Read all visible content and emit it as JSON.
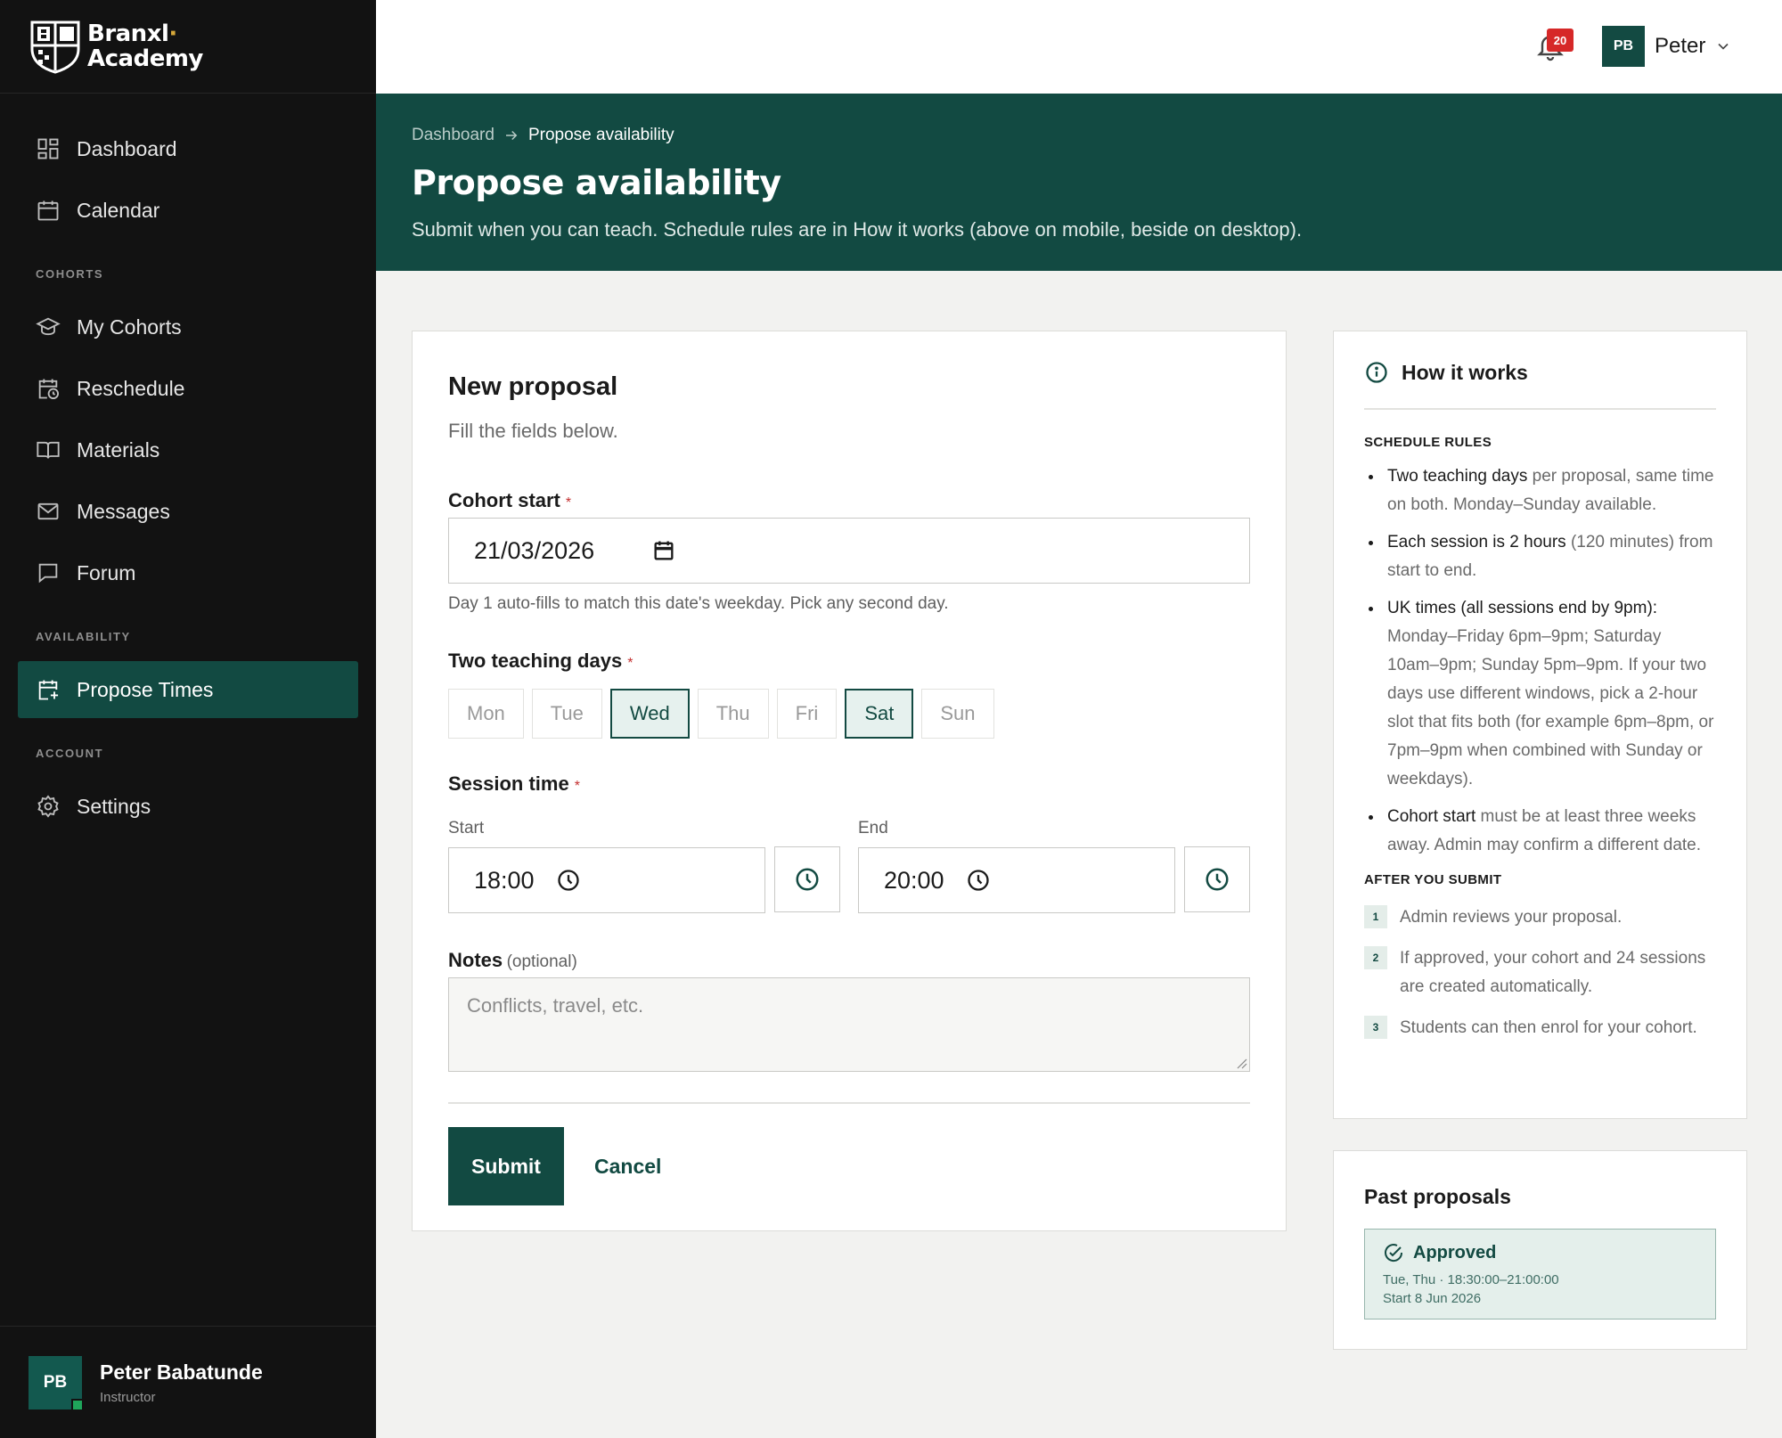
{
  "brand": {
    "line1": "Branxl",
    "line2": "Academy"
  },
  "sidebar": {
    "top_items": [
      {
        "label": "Dashboard",
        "icon": "dashboard-icon"
      },
      {
        "label": "Calendar",
        "icon": "calendar-icon"
      }
    ],
    "sections": [
      {
        "title": "COHORTS",
        "items": [
          {
            "label": "My Cohorts",
            "icon": "graduation-cap-icon"
          },
          {
            "label": "Reschedule",
            "icon": "calendar-clock-icon"
          },
          {
            "label": "Materials",
            "icon": "book-icon"
          },
          {
            "label": "Messages",
            "icon": "mail-icon"
          },
          {
            "label": "Forum",
            "icon": "chat-icon"
          }
        ]
      },
      {
        "title": "AVAILABILITY",
        "items": [
          {
            "label": "Propose Times",
            "icon": "calendar-plus-icon",
            "active": true
          }
        ]
      },
      {
        "title": "ACCOUNT",
        "items": [
          {
            "label": "Settings",
            "icon": "gear-icon"
          }
        ]
      }
    ],
    "profile": {
      "initials": "PB",
      "name": "Peter Babatunde",
      "role": "Instructor"
    }
  },
  "header": {
    "notification_count": "20",
    "user_initials": "PB",
    "user_name": "Peter"
  },
  "hero": {
    "breadcrumb_home": "Dashboard",
    "breadcrumb_current": "Propose availability",
    "title": "Propose availability",
    "subtitle": "Submit when you can teach. Schedule rules are in How it works (above on mobile, beside on desktop)."
  },
  "form": {
    "title": "New proposal",
    "subtitle": "Fill the fields below.",
    "cohort_start_label": "Cohort start",
    "cohort_start_value": "21/03/2026",
    "cohort_start_help": "Day 1 auto-fills to match this date's weekday. Pick any second day.",
    "teaching_days_label": "Two teaching days",
    "days": [
      {
        "label": "Mon",
        "selected": false
      },
      {
        "label": "Tue",
        "selected": false
      },
      {
        "label": "Wed",
        "selected": true
      },
      {
        "label": "Thu",
        "selected": false
      },
      {
        "label": "Fri",
        "selected": false
      },
      {
        "label": "Sat",
        "selected": true
      },
      {
        "label": "Sun",
        "selected": false
      }
    ],
    "session_time_label": "Session time",
    "start_label": "Start",
    "start_value": "18:00",
    "end_label": "End",
    "end_value": "20:00",
    "notes_label": "Notes",
    "notes_optional": "(optional)",
    "notes_placeholder": "Conflicts, travel, etc.",
    "submit_label": "Submit",
    "cancel_label": "Cancel"
  },
  "how": {
    "title": "How it works",
    "rules_title": "SCHEDULE RULES",
    "rules": [
      {
        "strong": "Two teaching days",
        "rest": " per proposal, same time on both. Monday–Sunday available."
      },
      {
        "strong": "Each session is 2 hours",
        "rest": " (120 minutes) from start to end."
      },
      {
        "strong": "UK times (all sessions end by 9pm):",
        "rest": " Monday–Friday 6pm–9pm; Saturday 10am–9pm; Sunday 5pm–9pm. If your two days use different windows, pick a 2-hour slot that fits both (for example 6pm–8pm, or 7pm–9pm when combined with Sunday or weekdays)."
      },
      {
        "strong": "Cohort start",
        "rest": " must be at least three weeks away. Admin may confirm a different date."
      }
    ],
    "after_title": "AFTER YOU SUBMIT",
    "steps": [
      {
        "num": "1",
        "text": "Admin reviews your proposal."
      },
      {
        "num": "2",
        "text": "If approved, your cohort and 24 sessions are created automatically."
      },
      {
        "num": "3",
        "text": "Students can then enrol for your cohort."
      }
    ]
  },
  "past": {
    "title": "Past proposals",
    "items": [
      {
        "status": "Approved",
        "days": "Tue, Thu · 18:30:00–21:00:00",
        "start": "Start 8 Jun 2026"
      }
    ]
  },
  "colors": {
    "primary": "#124a42",
    "sidebar_bg": "#121212",
    "page_bg": "#f2f2f0",
    "badge": "#d62828",
    "accent_gold": "#d6a83a"
  }
}
